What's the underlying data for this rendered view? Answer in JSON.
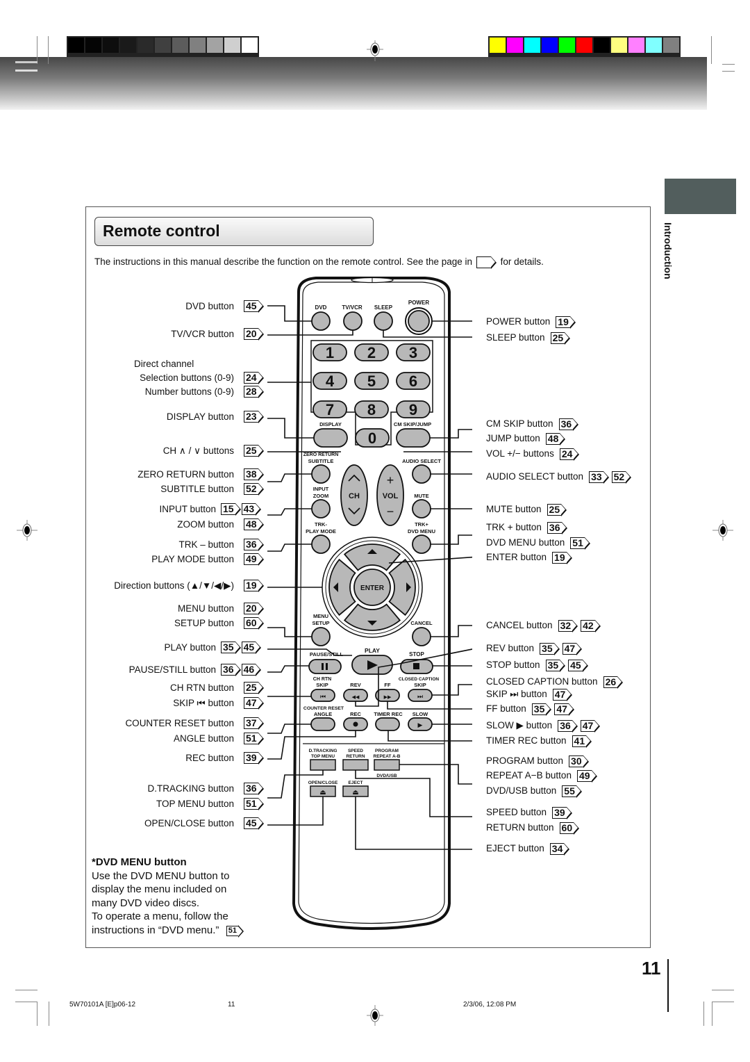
{
  "header": {
    "gray_swatches": [
      "#000000",
      "#050505",
      "#0e0e0e",
      "#1a1a1a",
      "#2a2a2a",
      "#404040",
      "#5c5c5c",
      "#808080",
      "#a3a3a3",
      "#cfcfcf",
      "#ffffff"
    ],
    "color_swatches": [
      "#ffff00",
      "#ff00ff",
      "#00ffff",
      "#0000ff",
      "#00ff00",
      "#ff0000",
      "#000000",
      "#ffff80",
      "#ff80ff",
      "#80ffff",
      "#808080"
    ]
  },
  "sidebar": {
    "section": "Introduction",
    "tab_color": "#525e5d"
  },
  "title": "Remote control",
  "intro": {
    "before": "The instructions in this manual describe the function on the remote control. See the page in",
    "after": "for details."
  },
  "remote": {
    "keys": {
      "dvd": "DVD",
      "tvvcr": "TV/VCR",
      "sleep": "SLEEP",
      "power": "POWER",
      "digits": [
        "1",
        "2",
        "3",
        "4",
        "5",
        "6",
        "7",
        "8",
        "9",
        "0"
      ],
      "display": "DISPLAY",
      "cmskip": "CM SKIP/JUMP",
      "zero_return": "ZERO RETURN",
      "subtitle": "SUBTITLE",
      "audio_select": "AUDIO SELECT",
      "input": "INPUT",
      "zoom": "ZOOM",
      "ch": "CH",
      "vol": "VOL",
      "mute": "MUTE",
      "trk_minus": "TRK-",
      "play_mode": "PLAY MODE",
      "trk_plus": "TRK+",
      "dvd_menu": "DVD MENU",
      "enter": "ENTER",
      "menu": "MENU",
      "setup": "SETUP",
      "cancel": "CANCEL",
      "pause_still": "PAUSE/STILL",
      "play": "PLAY",
      "stop": "STOP",
      "ch_rtn": "CH RTN",
      "skip": "SKIP",
      "rev": "REV",
      "ff": "FF",
      "closed_caption": "CLOSED CAPTION",
      "counter_reset": "COUNTER RESET",
      "angle": "ANGLE",
      "rec": "REC",
      "timer_rec": "TIMER REC",
      "slow": "SLOW",
      "d_tracking": "D.TRACKING",
      "top_menu": "TOP MENU",
      "speed": "SPEED",
      "return": "RETURN",
      "program": "PROGRAM",
      "repeat_ab": "REPEAT A-B",
      "dvd_usb": "DVD/USB",
      "open_close": "OPEN/CLOSE",
      "eject": "EJECT"
    }
  },
  "left_labels": [
    {
      "text": "DVD button",
      "refs": [
        "45"
      ]
    },
    {
      "text": "TV/VCR button",
      "refs": [
        "20"
      ]
    },
    {
      "text": "Direct channel",
      "refs": []
    },
    {
      "text": "Selection buttons (0-9)",
      "refs": [
        "24"
      ]
    },
    {
      "text": "Number buttons (0-9)",
      "refs": [
        "28"
      ]
    },
    {
      "text": "DISPLAY button",
      "refs": [
        "23"
      ]
    },
    {
      "text": "CH ∧ / ∨ buttons",
      "refs": [
        "25"
      ]
    },
    {
      "text": "ZERO RETURN button",
      "refs": [
        "38"
      ]
    },
    {
      "text": "SUBTITLE button",
      "refs": [
        "52"
      ]
    },
    {
      "text": "INPUT button",
      "refs": [
        "15",
        "43"
      ]
    },
    {
      "text": "ZOOM button",
      "refs": [
        "48"
      ]
    },
    {
      "text": "TRK – button",
      "refs": [
        "36"
      ]
    },
    {
      "text": "PLAY MODE button",
      "refs": [
        "49"
      ]
    },
    {
      "text": "Direction buttons (▲/▼/◀/▶)",
      "refs": [
        "19"
      ]
    },
    {
      "text": "MENU button",
      "refs": [
        "20"
      ]
    },
    {
      "text": "SETUP button",
      "refs": [
        "60"
      ]
    },
    {
      "text": "PLAY button",
      "refs": [
        "35",
        "45"
      ]
    },
    {
      "text": "PAUSE/STILL button",
      "refs": [
        "36",
        "46"
      ]
    },
    {
      "text": "CH RTN button",
      "refs": [
        "25"
      ]
    },
    {
      "text": "SKIP ⏮ button",
      "refs": [
        "47"
      ]
    },
    {
      "text": "COUNTER RESET button",
      "refs": [
        "37"
      ]
    },
    {
      "text": "ANGLE button",
      "refs": [
        "51"
      ]
    },
    {
      "text": "REC button",
      "refs": [
        "39"
      ]
    },
    {
      "text": "D.TRACKING button",
      "refs": [
        "36"
      ]
    },
    {
      "text": "TOP MENU button",
      "refs": [
        "51"
      ]
    },
    {
      "text": "OPEN/CLOSE button",
      "refs": [
        "45"
      ]
    }
  ],
  "right_labels": [
    {
      "text": "POWER button",
      "refs": [
        "19"
      ]
    },
    {
      "text": "SLEEP button",
      "refs": [
        "25"
      ]
    },
    {
      "text": "CM SKIP button",
      "refs": [
        "36"
      ]
    },
    {
      "text": "JUMP button",
      "refs": [
        "48"
      ]
    },
    {
      "text": "VOL +/−  buttons",
      "refs": [
        "24"
      ]
    },
    {
      "text": "AUDIO SELECT button",
      "refs": [
        "33",
        "52"
      ]
    },
    {
      "text": "MUTE button",
      "refs": [
        "25"
      ]
    },
    {
      "text": "TRK + button",
      "refs": [
        "36"
      ]
    },
    {
      "text": "DVD MENU button",
      "refs": [
        "51"
      ]
    },
    {
      "text": "ENTER button",
      "refs": [
        "19"
      ]
    },
    {
      "text": "CANCEL button",
      "refs": [
        "32",
        "42"
      ]
    },
    {
      "text": "REV button",
      "refs": [
        "35",
        "47"
      ]
    },
    {
      "text": "STOP button",
      "refs": [
        "35",
        "45"
      ]
    },
    {
      "text": "CLOSED CAPTION button",
      "refs": [
        "26"
      ]
    },
    {
      "text": "SKIP ⏭ button",
      "refs": [
        "47"
      ]
    },
    {
      "text": "FF button",
      "refs": [
        "35",
        "47"
      ]
    },
    {
      "text": "SLOW ▶ button",
      "refs": [
        "36",
        "47"
      ]
    },
    {
      "text": "TIMER REC button",
      "refs": [
        "41"
      ]
    },
    {
      "text": "PROGRAM button",
      "refs": [
        "30"
      ]
    },
    {
      "text": "REPEAT A−B button",
      "refs": [
        "49"
      ]
    },
    {
      "text": "DVD/USB button",
      "refs": [
        "55"
      ]
    },
    {
      "text": "SPEED button",
      "refs": [
        "39"
      ]
    },
    {
      "text": "RETURN button",
      "refs": [
        "60"
      ]
    },
    {
      "text": "EJECT button",
      "refs": [
        "34"
      ]
    }
  ],
  "note": {
    "heading": "*DVD MENU button",
    "lines": [
      "Use the DVD MENU button to",
      "display the menu included on",
      "many DVD video discs.",
      "To operate a menu, follow the",
      "instructions in “DVD menu.”"
    ],
    "ref": "51"
  },
  "page_number": "11",
  "footer": {
    "code": "5W70101A [E]p06-12",
    "page": "11",
    "timestamp": "2/3/06, 12:08 PM"
  }
}
